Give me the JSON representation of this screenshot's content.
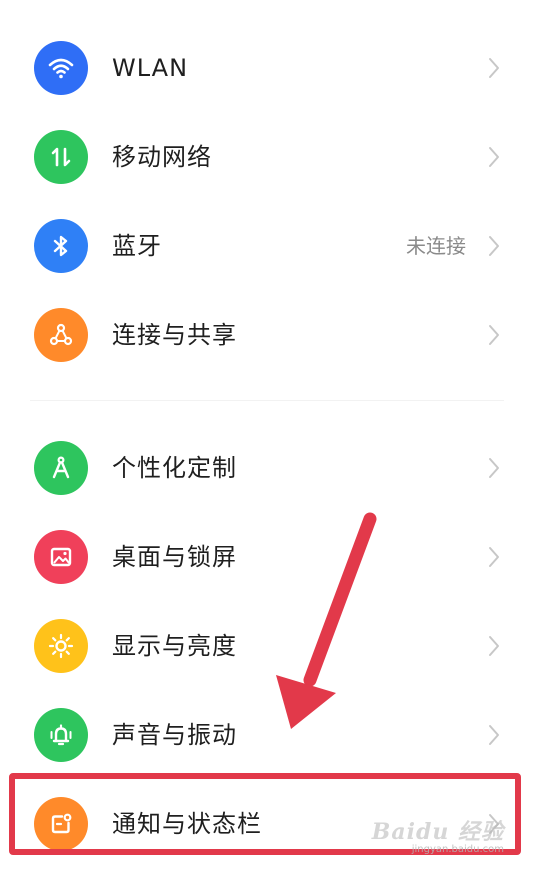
{
  "settings": {
    "items": [
      {
        "label": "WLAN",
        "icon": "wifi-icon",
        "color": "#2f6ef6",
        "status": ""
      },
      {
        "label": "移动网络",
        "icon": "mobile-data-icon",
        "color": "#2ec55e",
        "status": ""
      },
      {
        "label": "蓝牙",
        "icon": "bluetooth-icon",
        "color": "#2f80f6",
        "status": "未连接"
      },
      {
        "label": "连接与共享",
        "icon": "share-icon",
        "color": "#ff8a2a",
        "status": ""
      },
      {
        "label": "个性化定制",
        "icon": "compass-icon",
        "color": "#2ec55e",
        "status": ""
      },
      {
        "label": "桌面与锁屏",
        "icon": "wallpaper-icon",
        "color": "#f0405a",
        "status": ""
      },
      {
        "label": "显示与亮度",
        "icon": "brightness-icon",
        "color": "#ffc21a",
        "status": ""
      },
      {
        "label": "声音与振动",
        "icon": "bell-vibrate-icon",
        "color": "#2ec55e",
        "status": ""
      },
      {
        "label": "通知与状态栏",
        "icon": "notification-icon",
        "color": "#ff8a2a",
        "status": ""
      }
    ]
  },
  "annotation": {
    "highlight_color": "#e2394a",
    "highlighted_item": "通知与状态栏"
  },
  "watermark": {
    "brand": "Baidu 经验",
    "url": "jingyan.baidu.com"
  }
}
